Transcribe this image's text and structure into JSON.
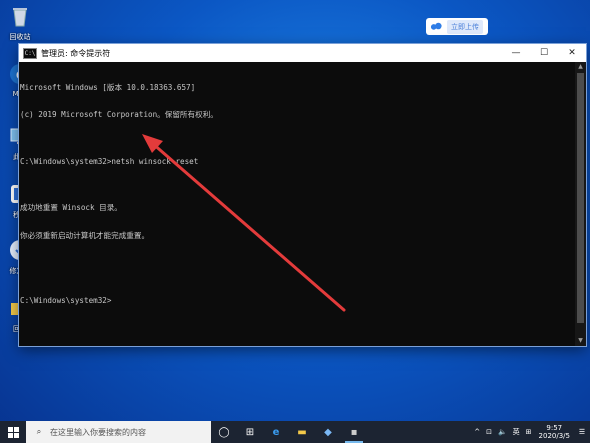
{
  "desktop": {
    "icons": [
      {
        "label": "回收站",
        "icon": "recycle-bin-icon"
      },
      {
        "label": "Micr",
        "icon": "edge-icon"
      },
      {
        "label": "此电",
        "icon": "this-pc-icon"
      },
      {
        "label": "秒关",
        "icon": "app-icon"
      },
      {
        "label": "修复开",
        "icon": "repair-icon"
      },
      {
        "label": "回收",
        "icon": "folder-icon"
      }
    ]
  },
  "cloud_badge": {
    "button_label": "立即上传",
    "icon": "baidu-cloud-icon"
  },
  "window": {
    "title": "管理员: 命令提示符",
    "app_icon_text": "C:\\",
    "minimize": "—",
    "maximize": "☐",
    "close": "✕",
    "lines": [
      "Microsoft Windows [版本 10.0.18363.657]",
      "(c) 2019 Microsoft Corporation。保留所有权利。",
      "",
      "C:\\Windows\\system32>netsh winsock reset",
      "",
      "成功地重置 Winsock 目录。",
      "你必须重新启动计算机才能完成重置。",
      "",
      "",
      "C:\\Windows\\system32>"
    ]
  },
  "taskbar": {
    "search_placeholder": "在这里输入你要搜索的内容",
    "apps": [
      {
        "name": "task-view",
        "glyph": "◯"
      },
      {
        "name": "multitask",
        "glyph": "⊞"
      },
      {
        "name": "edge",
        "glyph": "e"
      },
      {
        "name": "explorer",
        "glyph": "▬"
      },
      {
        "name": "store",
        "glyph": "◆"
      },
      {
        "name": "cmd",
        "glyph": "▪"
      }
    ],
    "tray": {
      "chevron": "^",
      "network": "⊡",
      "volume": "🔈",
      "lang": "英",
      "ime": "⊞",
      "time": "9:57",
      "date": "2020/3/5"
    }
  },
  "colors": {
    "accent": "#1f86e8",
    "console_bg": "#0c0c0c",
    "arrow": "#e33b3b"
  }
}
